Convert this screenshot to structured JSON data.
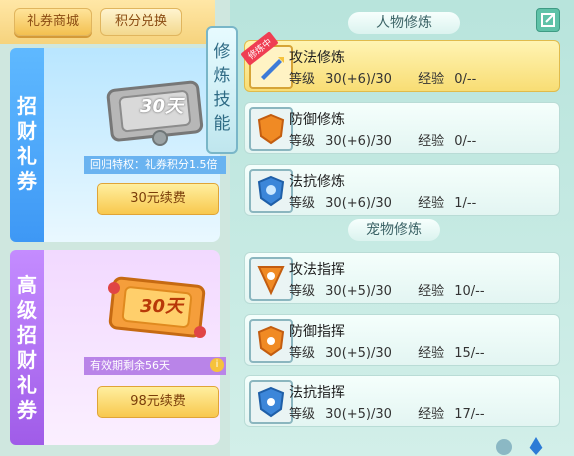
{
  "shop": {
    "tabs": [
      "礼券商城",
      "积分兑换"
    ]
  },
  "cards": [
    {
      "title_chars": [
        "招",
        "财",
        "礼",
        "券"
      ],
      "ticket_label": "30天",
      "strip_text": "回归特权：礼券积分1.5倍",
      "button": "30元续费"
    },
    {
      "title_chars": [
        "高",
        "级",
        "招",
        "财",
        "礼",
        "券"
      ],
      "ticket_label": "30天",
      "strip_text": "有效期剩余56天",
      "button": "98元续费"
    }
  ],
  "panel": {
    "side_tab_chars": [
      "修",
      "炼",
      "技",
      "能"
    ],
    "sections": [
      {
        "title": "人物修炼",
        "skills": [
          {
            "name": "攻法修炼",
            "level_label": "等级",
            "level": "30(+6)/30",
            "exp_label": "经验",
            "exp": "0/--",
            "badge": "修炼中"
          },
          {
            "name": "防御修炼",
            "level_label": "等级",
            "level": "30(+6)/30",
            "exp_label": "经验",
            "exp": "0/--"
          },
          {
            "name": "法抗修炼",
            "level_label": "等级",
            "level": "30(+6)/30",
            "exp_label": "经验",
            "exp": "1/--"
          }
        ]
      },
      {
        "title": "宠物修炼",
        "skills": [
          {
            "name": "攻法指挥",
            "level_label": "等级",
            "level": "30(+5)/30",
            "exp_label": "经验",
            "exp": "10/--"
          },
          {
            "name": "防御指挥",
            "level_label": "等级",
            "level": "30(+5)/30",
            "exp_label": "经验",
            "exp": "15/--"
          },
          {
            "name": "法抗指挥",
            "level_label": "等级",
            "level": "30(+5)/30",
            "exp_label": "经验",
            "exp": "17/--"
          }
        ]
      }
    ]
  },
  "colors": {
    "selected": "#f8dd74",
    "accent": "#3e98f5",
    "purple": "#a05ce8"
  }
}
